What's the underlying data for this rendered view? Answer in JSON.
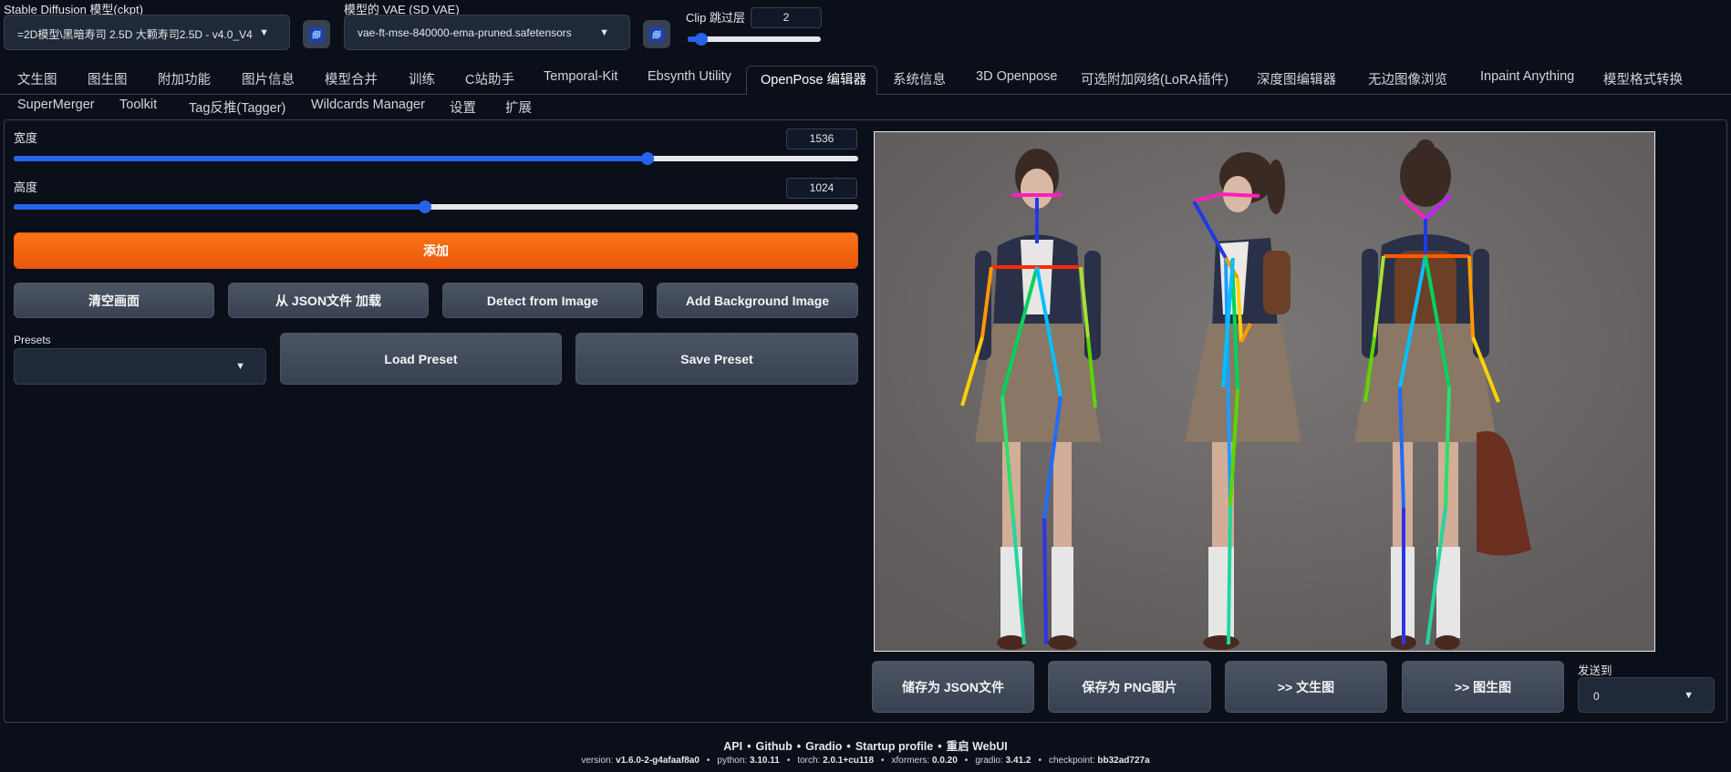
{
  "header": {
    "ckpt_label": "Stable Diffusion 模型(ckpt)",
    "ckpt_value": "=2D模型\\黑暗寿司 2.5D 大颗寿司2.5D - v4.0_V4",
    "vae_label": "模型的 VAE (SD VAE)",
    "vae_value": "vae-ft-mse-840000-ema-pruned.safetensors",
    "clip_label": "Clip 跳过层",
    "clip_value": "2",
    "clip_slider_fraction": 0.1
  },
  "tabs": [
    {
      "label": "文生图"
    },
    {
      "label": "图生图"
    },
    {
      "label": "附加功能"
    },
    {
      "label": "图片信息"
    },
    {
      "label": "模型合并"
    },
    {
      "label": "训练"
    },
    {
      "label": "C站助手"
    },
    {
      "label": "Temporal-Kit"
    },
    {
      "label": "Ebsynth Utility"
    },
    {
      "label": "OpenPose 编辑器",
      "active": true
    },
    {
      "label": "系统信息"
    },
    {
      "label": "3D Openpose"
    },
    {
      "label": "可选附加网络(LoRA插件)"
    },
    {
      "label": "深度图编辑器"
    },
    {
      "label": "无边图像浏览"
    },
    {
      "label": "Inpaint Anything"
    },
    {
      "label": "模型格式转换"
    },
    {
      "label": "SuperMerger"
    },
    {
      "label": "Toolkit"
    },
    {
      "label": "Tag反推(Tagger)"
    },
    {
      "label": "Wildcards Manager"
    },
    {
      "label": "设置"
    },
    {
      "label": "扩展"
    }
  ],
  "editor": {
    "width_label": "宽度",
    "width_value": "1536",
    "width_fraction": 0.75,
    "height_label": "高度",
    "height_value": "1024",
    "height_fraction": 0.487,
    "add_button": "添加",
    "clear_button": "清空画面",
    "load_json_button": "从 JSON文件 加载",
    "detect_button": "Detect from Image",
    "add_bg_button": "Add Background Image",
    "presets_label": "Presets",
    "presets_value": "",
    "load_preset_button": "Load Preset",
    "save_preset_button": "Save Preset"
  },
  "output": {
    "save_json_button": "储存为 JSON文件",
    "save_png_button": "保存为 PNG图片",
    "to_txt2img_button": ">> 文生图",
    "to_img2img_button": ">> 图生图",
    "send_to_label": "发送到",
    "send_to_value": "0"
  },
  "footer": {
    "links": [
      "API",
      "Github",
      "Gradio",
      "Startup profile",
      "重启 WebUI"
    ],
    "separator": "•",
    "version_items": [
      {
        "key": "version:",
        "value": "v1.6.0-2-g4afaaf8a0"
      },
      {
        "key": "python:",
        "value": "3.10.11"
      },
      {
        "key": "torch:",
        "value": "2.0.1+cu118"
      },
      {
        "key": "xformers:",
        "value": "0.0.20"
      },
      {
        "key": "gradio:",
        "value": "3.41.2"
      },
      {
        "key": "checkpoint:",
        "value": "bb32ad727a"
      }
    ]
  },
  "colors": {
    "background": "#0b0f19",
    "accent_orange": "#f97316",
    "slider_blue": "#2563eb"
  },
  "icons": {
    "refresh": "refresh-icon",
    "dropdown": "chevron-down-icon"
  }
}
